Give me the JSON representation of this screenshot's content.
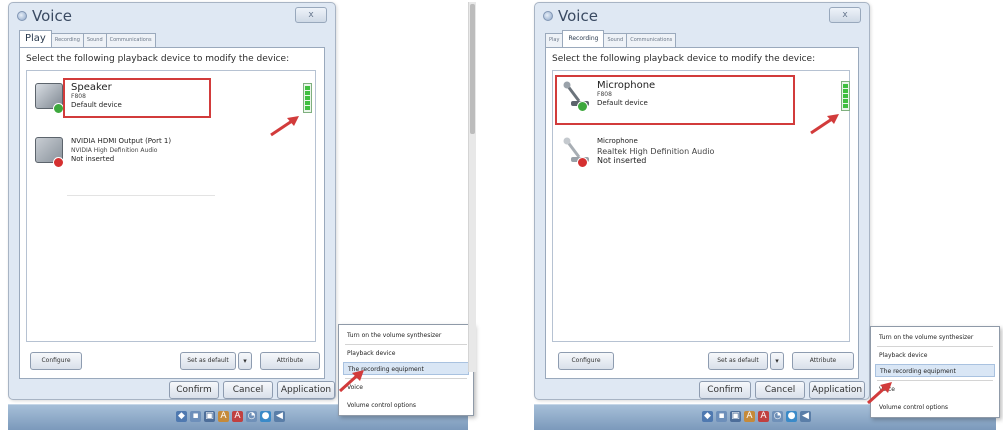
{
  "left": {
    "title": "Voice",
    "tabs": [
      "Play",
      "Recording",
      "Sound",
      "Communications"
    ],
    "instruction": "Select the following playback device to modify the device:",
    "devices": [
      {
        "name": "Speaker",
        "model": "F808",
        "state": "Default device",
        "icon": "speaker-icon",
        "status": "default"
      },
      {
        "name": "NVIDIA HDMI Output (Port 1)",
        "model": "NVIDIA High Definition Audio",
        "state": "Not inserted",
        "icon": "monitor-icon",
        "status": "disconnected"
      }
    ],
    "buttons": {
      "configure": "Configure",
      "set_default": "Set as default",
      "properties": "Attribute",
      "confirm": "Confirm",
      "cancel": "Cancel",
      "apply": "Application"
    },
    "context_menu": [
      "Turn on the volume synthesizer",
      "Playback device",
      "The recording equipment",
      "Voice",
      "Volume control options"
    ]
  },
  "right": {
    "title": "Voice",
    "tabs": [
      "Play",
      "Recording",
      "Sound",
      "Communications"
    ],
    "instruction": "Select the following playback device to modify the device:",
    "devices": [
      {
        "name": "Microphone",
        "model": "F808",
        "state": "Default device",
        "icon": "microphone-icon",
        "status": "default"
      },
      {
        "name": "Microphone",
        "model": "Realtek High Definition Audio",
        "state": "Not inserted",
        "icon": "microphone-icon",
        "status": "disconnected"
      }
    ],
    "buttons": {
      "configure": "Configure",
      "set_default": "Set as default",
      "properties": "Attribute",
      "confirm": "Confirm",
      "cancel": "Cancel",
      "apply": "Application"
    },
    "context_menu": [
      "Turn on the volume synthesizer",
      "Playback device",
      "The recording equipment",
      "Voice",
      "Volume control options"
    ]
  },
  "colors": {
    "highlight": "#d23b3b",
    "meter": "#3fbf3f",
    "dialog_bg": "#dfe8f3",
    "taskbar": "#8aa6c6"
  },
  "icons": [
    "speaker-icon",
    "monitor-icon",
    "microphone-icon",
    "level-meter-icon",
    "red-arrow-icon"
  ]
}
